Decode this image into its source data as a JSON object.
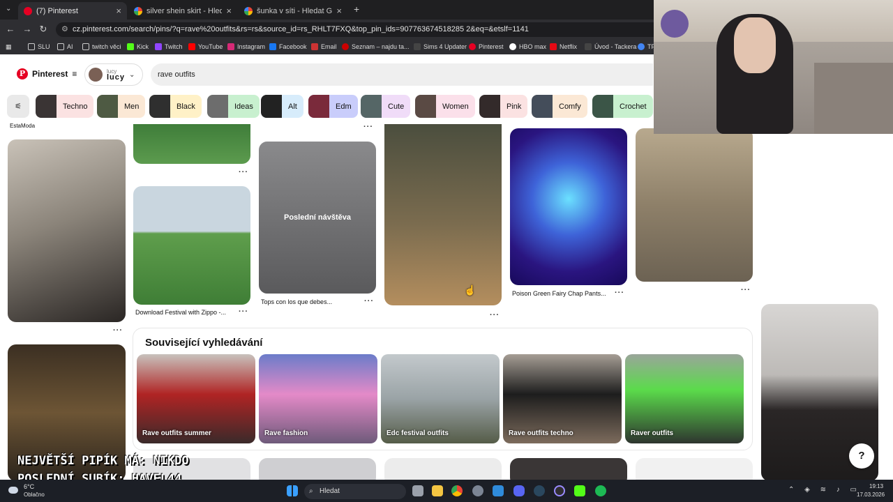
{
  "browser": {
    "tabs": [
      {
        "title": "(7) Pinterest",
        "icon": "pinterest-icon",
        "active": true
      },
      {
        "title": "silver shein skirt - Hledat Googl",
        "icon": "google-icon",
        "active": false
      },
      {
        "title": "šunka v síti - Hledat Googlem",
        "icon": "google-icon",
        "active": false
      }
    ],
    "new_tab": "+",
    "url": "cz.pinterest.com/search/pins/?q=rave%20outfits&rs=rs&source_id=rs_RHLT7FXQ&top_pin_ids=907763674518285 2&eq=&etslf=1141",
    "bookmarks": [
      "SLU",
      "AI",
      "twitch věci",
      "Kick",
      "Twitch",
      "YouTube",
      "Instagram",
      "Facebook",
      "Email",
      "Seznam – najdu ta...",
      "Sims 4 Updater",
      "Pinterest",
      "HBO max",
      "Netflix",
      "Úvod - Tackera",
      "TP"
    ]
  },
  "pinterest": {
    "logo": "Pinterest",
    "account": {
      "label": "lucy",
      "name": "lucy"
    },
    "search_value": "rave outfits",
    "chips": [
      "Techno",
      "Men",
      "Black",
      "Ideas",
      "Alt",
      "Edm",
      "Cute",
      "Women",
      "Pink",
      "Comfy",
      "Crochet"
    ],
    "pins": {
      "top_title": "EstaModa",
      "titles": [
        "Download Festival with Zippo -...",
        "Tops con los que debes...",
        "Poison Green Fairy Chap Pants..."
      ],
      "overlay_label": "Poslední návštěva"
    },
    "related": {
      "heading": "Související vyhledávání",
      "items": [
        "Rave outfits summer",
        "Rave fashion",
        "Edc festival outfits",
        "Rave outfits techno",
        "Raver outfits"
      ]
    },
    "help": "?"
  },
  "stream_overlay": {
    "line1": "NEJVĚTŠÍ PIPÍK MÁ: NIKDO",
    "line2": "POSLEDNÍ SUBÍK: HAVEL44"
  },
  "taskbar": {
    "weather_temp": "6°C",
    "weather_desc": "Oblačno",
    "search_placeholder": "Hledat",
    "time": "19:13",
    "date": "17.03.2026"
  }
}
